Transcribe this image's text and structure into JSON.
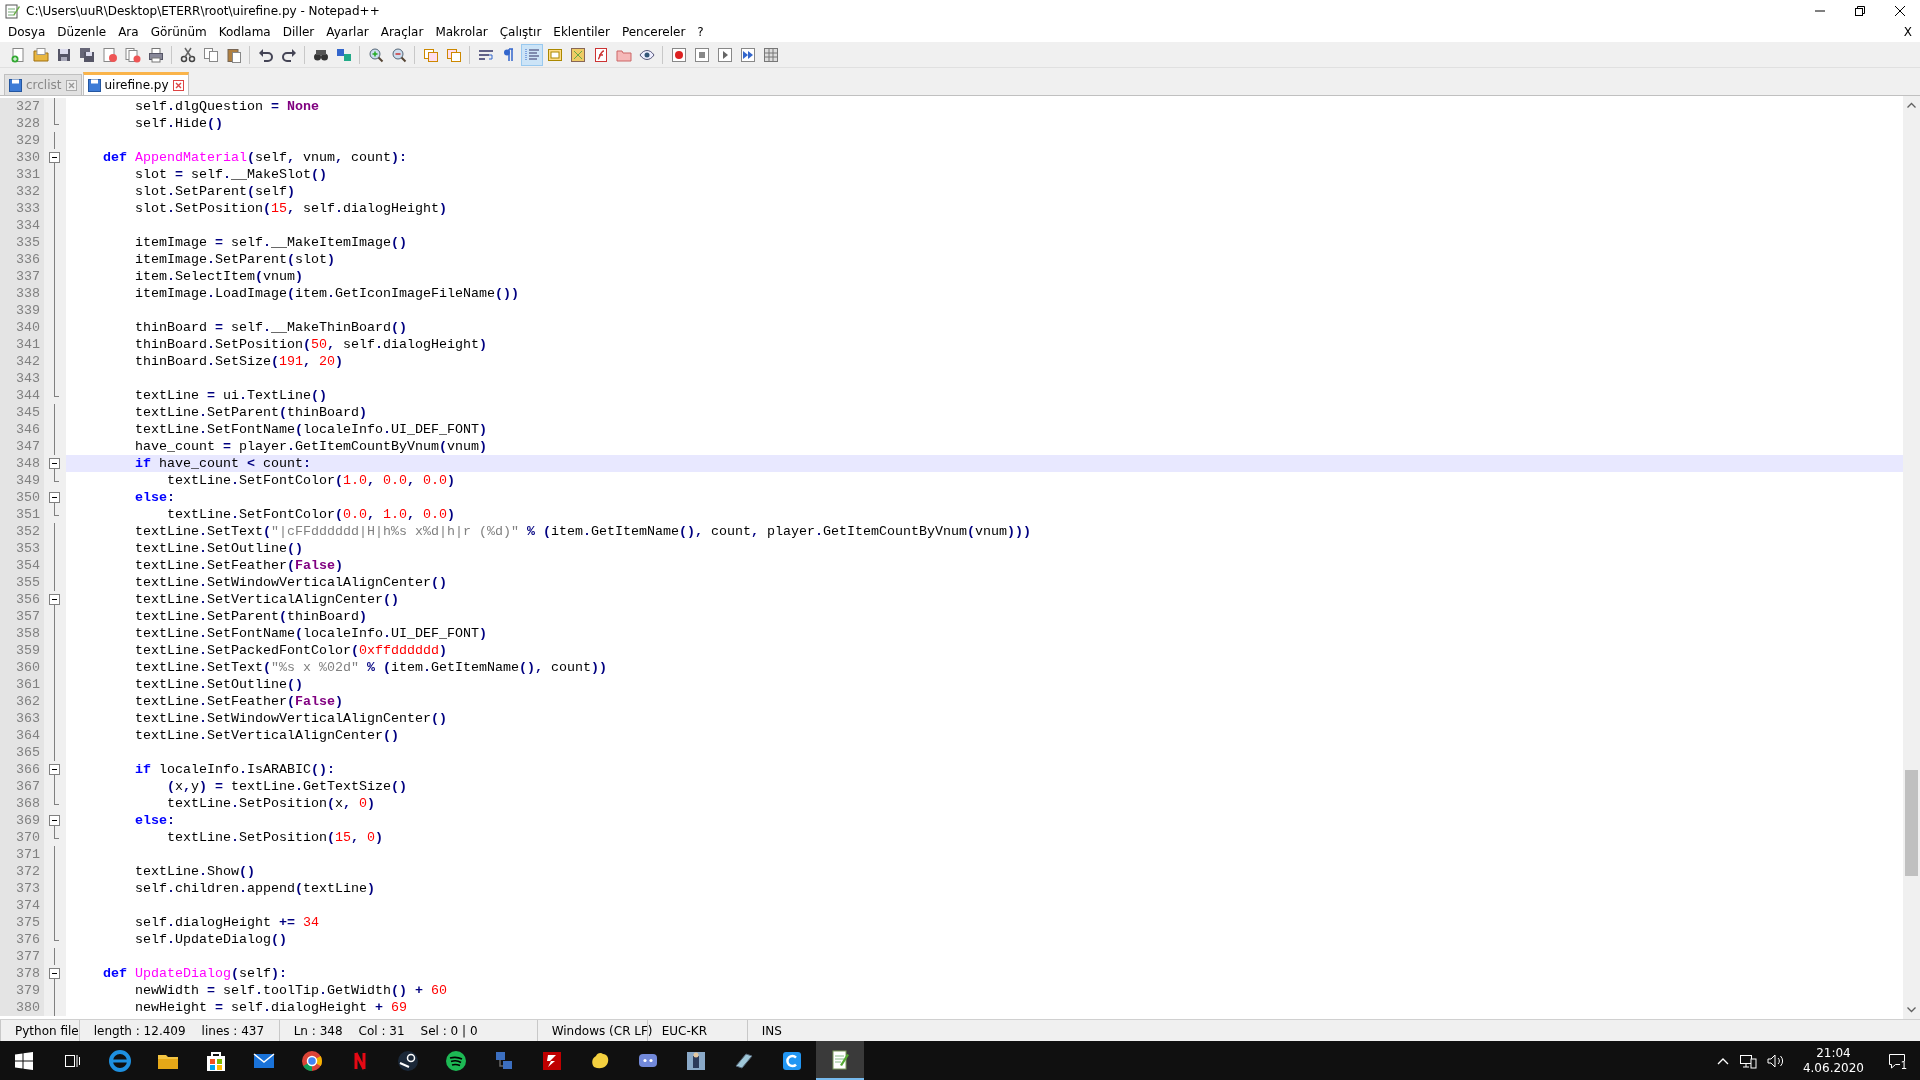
{
  "window": {
    "title": "C:\\Users\\uuR\\Desktop\\ETERR\\root\\uirefine.py - Notepad++"
  },
  "menu": {
    "items": [
      "Dosya",
      "Düzenle",
      "Ara",
      "Görünüm",
      "Kodlama",
      "Diller",
      "Ayarlar",
      "Araçlar",
      "Makrolar",
      "Çalıştır",
      "Eklentiler",
      "Pencereler",
      "?"
    ],
    "close_label": "X"
  },
  "toolbar": {
    "items": [
      {
        "kind": "button",
        "pressed": false
      },
      {
        "kind": "button",
        "pressed": false
      },
      {
        "kind": "button",
        "pressed": false
      },
      {
        "kind": "button",
        "pressed": false
      },
      {
        "kind": "button",
        "pressed": false
      },
      {
        "kind": "button",
        "pressed": false
      },
      {
        "kind": "button",
        "pressed": false
      },
      {
        "kind": "separator"
      },
      {
        "kind": "button",
        "pressed": false
      },
      {
        "kind": "button",
        "pressed": false
      },
      {
        "kind": "button",
        "pressed": false
      },
      {
        "kind": "separator"
      },
      {
        "kind": "button",
        "pressed": false
      },
      {
        "kind": "button",
        "pressed": false
      },
      {
        "kind": "separator"
      },
      {
        "kind": "button",
        "pressed": false
      },
      {
        "kind": "button",
        "pressed": false
      },
      {
        "kind": "separator"
      },
      {
        "kind": "button",
        "pressed": false
      },
      {
        "kind": "button",
        "pressed": false
      },
      {
        "kind": "separator"
      },
      {
        "kind": "button",
        "pressed": false
      },
      {
        "kind": "button",
        "pressed": false
      },
      {
        "kind": "separator"
      },
      {
        "kind": "button",
        "pressed": false
      },
      {
        "kind": "button",
        "pressed": false
      },
      {
        "kind": "button",
        "pressed": true
      },
      {
        "kind": "button",
        "pressed": false
      },
      {
        "kind": "button",
        "pressed": false
      },
      {
        "kind": "button",
        "pressed": false
      },
      {
        "kind": "button",
        "pressed": false
      },
      {
        "kind": "button",
        "pressed": false
      },
      {
        "kind": "separator"
      },
      {
        "kind": "button",
        "pressed": false
      },
      {
        "kind": "button",
        "pressed": false
      },
      {
        "kind": "button",
        "pressed": false
      },
      {
        "kind": "button",
        "pressed": false
      },
      {
        "kind": "button",
        "pressed": false
      }
    ]
  },
  "tabs": [
    {
      "label": "crclist",
      "selected": false
    },
    {
      "label": "uirefine.py",
      "selected": true
    }
  ],
  "editor": {
    "lines": [
      {
        "number": "327",
        "kind": "line",
        "selected": false,
        "tokens": [
          {
            "kind": "id",
            "text": "        self"
          },
          {
            "kind": "op",
            "text": "."
          },
          {
            "kind": "id",
            "text": "dlgQuestion "
          },
          {
            "kind": "op",
            "text": "="
          },
          {
            "kind": "constant",
            "text": " None"
          }
        ]
      },
      {
        "number": "328",
        "kind": "end",
        "selected": false,
        "tokens": [
          {
            "kind": "id",
            "text": "        self"
          },
          {
            "kind": "op",
            "text": "."
          },
          {
            "kind": "id",
            "text": "Hide"
          },
          {
            "kind": "op",
            "text": "()"
          }
        ]
      },
      {
        "number": "329",
        "kind": "line",
        "selected": false
      },
      {
        "number": "330",
        "kind": "open",
        "selected": false,
        "tokens": [
          {
            "kind": "keyword",
            "text": "    def "
          },
          {
            "kind": "defname",
            "text": "AppendMaterial"
          },
          {
            "kind": "op",
            "text": "("
          },
          {
            "kind": "id",
            "text": "self"
          },
          {
            "kind": "op",
            "text": ", "
          },
          {
            "kind": "id",
            "text": "vnum"
          },
          {
            "kind": "op",
            "text": ", "
          },
          {
            "kind": "id",
            "text": "count"
          },
          {
            "kind": "op",
            "text": "):"
          }
        ]
      },
      {
        "number": "331",
        "kind": "line",
        "selected": false,
        "tokens": [
          {
            "kind": "id",
            "text": "        slot "
          },
          {
            "kind": "op",
            "text": "="
          },
          {
            "kind": "id",
            "text": " self"
          },
          {
            "kind": "op",
            "text": "."
          },
          {
            "kind": "id",
            "text": "__MakeSlot"
          },
          {
            "kind": "op",
            "text": "()"
          }
        ]
      },
      {
        "number": "332",
        "kind": "line",
        "selected": false,
        "tokens": [
          {
            "kind": "id",
            "text": "        slot"
          },
          {
            "kind": "op",
            "text": "."
          },
          {
            "kind": "id",
            "text": "SetParent"
          },
          {
            "kind": "op",
            "text": "("
          },
          {
            "kind": "id",
            "text": "self"
          },
          {
            "kind": "op",
            "text": ")"
          }
        ]
      },
      {
        "number": "333",
        "kind": "line",
        "selected": false,
        "tokens": [
          {
            "kind": "id",
            "text": "        slot"
          },
          {
            "kind": "op",
            "text": "."
          },
          {
            "kind": "id",
            "text": "SetPosition"
          },
          {
            "kind": "op",
            "text": "("
          },
          {
            "kind": "number",
            "text": "15"
          },
          {
            "kind": "op",
            "text": ", "
          },
          {
            "kind": "id",
            "text": "self"
          },
          {
            "kind": "op",
            "text": "."
          },
          {
            "kind": "id",
            "text": "dialogHeight"
          },
          {
            "kind": "op",
            "text": ")"
          }
        ]
      },
      {
        "number": "334",
        "kind": "line",
        "selected": false
      },
      {
        "number": "335",
        "kind": "line",
        "selected": false,
        "tokens": [
          {
            "kind": "id",
            "text": "        itemImage "
          },
          {
            "kind": "op",
            "text": "="
          },
          {
            "kind": "id",
            "text": " self"
          },
          {
            "kind": "op",
            "text": "."
          },
          {
            "kind": "id",
            "text": "__MakeItemImage"
          },
          {
            "kind": "op",
            "text": "()"
          }
        ]
      },
      {
        "number": "336",
        "kind": "line",
        "selected": false,
        "tokens": [
          {
            "kind": "id",
            "text": "        itemImage"
          },
          {
            "kind": "op",
            "text": "."
          },
          {
            "kind": "id",
            "text": "SetParent"
          },
          {
            "kind": "op",
            "text": "("
          },
          {
            "kind": "id",
            "text": "slot"
          },
          {
            "kind": "op",
            "text": ")"
          }
        ]
      },
      {
        "number": "337",
        "kind": "line",
        "selected": false,
        "tokens": [
          {
            "kind": "id",
            "text": "        item"
          },
          {
            "kind": "op",
            "text": "."
          },
          {
            "kind": "id",
            "text": "SelectItem"
          },
          {
            "kind": "op",
            "text": "("
          },
          {
            "kind": "id",
            "text": "vnum"
          },
          {
            "kind": "op",
            "text": ")"
          }
        ]
      },
      {
        "number": "338",
        "kind": "line",
        "selected": false,
        "tokens": [
          {
            "kind": "id",
            "text": "        itemImage"
          },
          {
            "kind": "op",
            "text": "."
          },
          {
            "kind": "id",
            "text": "LoadImage"
          },
          {
            "kind": "op",
            "text": "("
          },
          {
            "kind": "id",
            "text": "item"
          },
          {
            "kind": "op",
            "text": "."
          },
          {
            "kind": "id",
            "text": "GetIconImageFileName"
          },
          {
            "kind": "op",
            "text": "())"
          }
        ]
      },
      {
        "number": "339",
        "kind": "line",
        "selected": false
      },
      {
        "number": "340",
        "kind": "line",
        "selected": false,
        "tokens": [
          {
            "kind": "id",
            "text": "        thinBoard "
          },
          {
            "kind": "op",
            "text": "="
          },
          {
            "kind": "id",
            "text": " self"
          },
          {
            "kind": "op",
            "text": "."
          },
          {
            "kind": "id",
            "text": "__MakeThinBoard"
          },
          {
            "kind": "op",
            "text": "()"
          }
        ]
      },
      {
        "number": "341",
        "kind": "line",
        "selected": false,
        "tokens": [
          {
            "kind": "id",
            "text": "        thinBoard"
          },
          {
            "kind": "op",
            "text": "."
          },
          {
            "kind": "id",
            "text": "SetPosition"
          },
          {
            "kind": "op",
            "text": "("
          },
          {
            "kind": "number",
            "text": "50"
          },
          {
            "kind": "op",
            "text": ", "
          },
          {
            "kind": "id",
            "text": "self"
          },
          {
            "kind": "op",
            "text": "."
          },
          {
            "kind": "id",
            "text": "dialogHeight"
          },
          {
            "kind": "op",
            "text": ")"
          }
        ]
      },
      {
        "number": "342",
        "kind": "line",
        "selected": false,
        "tokens": [
          {
            "kind": "id",
            "text": "        thinBoard"
          },
          {
            "kind": "op",
            "text": "."
          },
          {
            "kind": "id",
            "text": "SetSize"
          },
          {
            "kind": "op",
            "text": "("
          },
          {
            "kind": "number",
            "text": "191"
          },
          {
            "kind": "op",
            "text": ", "
          },
          {
            "kind": "number",
            "text": "20"
          },
          {
            "kind": "op",
            "text": ")"
          }
        ]
      },
      {
        "number": "343",
        "kind": "line",
        "selected": false
      },
      {
        "number": "344",
        "kind": "end",
        "selected": false,
        "tokens": [
          {
            "kind": "id",
            "text": "        textLine "
          },
          {
            "kind": "op",
            "text": "="
          },
          {
            "kind": "id",
            "text": " ui"
          },
          {
            "kind": "op",
            "text": "."
          },
          {
            "kind": "id",
            "text": "TextLine"
          },
          {
            "kind": "op",
            "text": "()"
          }
        ]
      },
      {
        "number": "345",
        "kind": "line",
        "selected": false,
        "tokens": [
          {
            "kind": "id",
            "text": "        textLine"
          },
          {
            "kind": "op",
            "text": "."
          },
          {
            "kind": "id",
            "text": "SetParent"
          },
          {
            "kind": "op",
            "text": "("
          },
          {
            "kind": "id",
            "text": "thinBoard"
          },
          {
            "kind": "op",
            "text": ")"
          }
        ]
      },
      {
        "number": "346",
        "kind": "line",
        "selected": false,
        "tokens": [
          {
            "kind": "id",
            "text": "        textLine"
          },
          {
            "kind": "op",
            "text": "."
          },
          {
            "kind": "id",
            "text": "SetFontName"
          },
          {
            "kind": "op",
            "text": "("
          },
          {
            "kind": "id",
            "text": "localeInfo"
          },
          {
            "kind": "op",
            "text": "."
          },
          {
            "kind": "id",
            "text": "UI_DEF_FONT"
          },
          {
            "kind": "op",
            "text": ")"
          }
        ]
      },
      {
        "number": "347",
        "kind": "line",
        "selected": false,
        "tokens": [
          {
            "kind": "id",
            "text": "        have_count "
          },
          {
            "kind": "op",
            "text": "="
          },
          {
            "kind": "id",
            "text": " player"
          },
          {
            "kind": "op",
            "text": "."
          },
          {
            "kind": "id",
            "text": "GetItemCountByVnum"
          },
          {
            "kind": "op",
            "text": "("
          },
          {
            "kind": "id",
            "text": "vnum"
          },
          {
            "kind": "op",
            "text": ")"
          }
        ]
      },
      {
        "number": "348",
        "kind": "open",
        "selected": true,
        "tokens": [
          {
            "kind": "keyword",
            "text": "        if"
          },
          {
            "kind": "id",
            "text": " have_count "
          },
          {
            "kind": "op",
            "text": "<"
          },
          {
            "kind": "id",
            "text": " count"
          },
          {
            "kind": "op",
            "text": ":"
          }
        ]
      },
      {
        "number": "349",
        "kind": "end",
        "selected": false,
        "tokens": [
          {
            "kind": "id",
            "text": "            textLine"
          },
          {
            "kind": "op",
            "text": "."
          },
          {
            "kind": "id",
            "text": "SetFontColor"
          },
          {
            "kind": "op",
            "text": "("
          },
          {
            "kind": "number",
            "text": "1.0"
          },
          {
            "kind": "op",
            "text": ", "
          },
          {
            "kind": "number",
            "text": "0.0"
          },
          {
            "kind": "op",
            "text": ", "
          },
          {
            "kind": "number",
            "text": "0.0"
          },
          {
            "kind": "op",
            "text": ")"
          }
        ]
      },
      {
        "number": "350",
        "kind": "open",
        "selected": false,
        "tokens": [
          {
            "kind": "keyword",
            "text": "        else"
          },
          {
            "kind": "op",
            "text": ":"
          }
        ]
      },
      {
        "number": "351",
        "kind": "end",
        "selected": false,
        "tokens": [
          {
            "kind": "id",
            "text": "            textLine"
          },
          {
            "kind": "op",
            "text": "."
          },
          {
            "kind": "id",
            "text": "SetFontColor"
          },
          {
            "kind": "op",
            "text": "("
          },
          {
            "kind": "number",
            "text": "0.0"
          },
          {
            "kind": "op",
            "text": ", "
          },
          {
            "kind": "number",
            "text": "1.0"
          },
          {
            "kind": "op",
            "text": ", "
          },
          {
            "kind": "number",
            "text": "0.0"
          },
          {
            "kind": "op",
            "text": ")"
          }
        ]
      },
      {
        "number": "352",
        "kind": "line",
        "selected": false,
        "tokens": [
          {
            "kind": "id",
            "text": "        textLine"
          },
          {
            "kind": "op",
            "text": "."
          },
          {
            "kind": "id",
            "text": "SetText"
          },
          {
            "kind": "op",
            "text": "("
          },
          {
            "kind": "string",
            "text": "\"|cFFdddddd|H|h%s x%d|h|r (%d)\""
          },
          {
            "kind": "op",
            "text": " % ("
          },
          {
            "kind": "id",
            "text": "item"
          },
          {
            "kind": "op",
            "text": "."
          },
          {
            "kind": "id",
            "text": "GetItemName"
          },
          {
            "kind": "op",
            "text": "(), "
          },
          {
            "kind": "id",
            "text": "count"
          },
          {
            "kind": "op",
            "text": ", "
          },
          {
            "kind": "id",
            "text": "player"
          },
          {
            "kind": "op",
            "text": "."
          },
          {
            "kind": "id",
            "text": "GetItemCountByVnum"
          },
          {
            "kind": "op",
            "text": "("
          },
          {
            "kind": "id",
            "text": "vnum"
          },
          {
            "kind": "op",
            "text": ")))"
          }
        ]
      },
      {
        "number": "353",
        "kind": "line",
        "selected": false,
        "tokens": [
          {
            "kind": "id",
            "text": "        textLine"
          },
          {
            "kind": "op",
            "text": "."
          },
          {
            "kind": "id",
            "text": "SetOutline"
          },
          {
            "kind": "op",
            "text": "()"
          }
        ]
      },
      {
        "number": "354",
        "kind": "line",
        "selected": false,
        "tokens": [
          {
            "kind": "id",
            "text": "        textLine"
          },
          {
            "kind": "op",
            "text": "."
          },
          {
            "kind": "id",
            "text": "SetFeather"
          },
          {
            "kind": "op",
            "text": "("
          },
          {
            "kind": "constant",
            "text": "False"
          },
          {
            "kind": "op",
            "text": ")"
          }
        ]
      },
      {
        "number": "355",
        "kind": "line",
        "selected": false,
        "tokens": [
          {
            "kind": "id",
            "text": "        textLine"
          },
          {
            "kind": "op",
            "text": "."
          },
          {
            "kind": "id",
            "text": "SetWindowVerticalAlignCenter"
          },
          {
            "kind": "op",
            "text": "()"
          }
        ]
      },
      {
        "number": "356",
        "kind": "open",
        "selected": false,
        "tokens": [
          {
            "kind": "id",
            "text": "        textLine"
          },
          {
            "kind": "op",
            "text": "."
          },
          {
            "kind": "id",
            "text": "SetVerticalAlignCenter"
          },
          {
            "kind": "op",
            "text": "()"
          }
        ]
      },
      {
        "number": "357",
        "kind": "line",
        "selected": false,
        "tokens": [
          {
            "kind": "id",
            "text": "        textLine"
          },
          {
            "kind": "op",
            "text": "."
          },
          {
            "kind": "id",
            "text": "SetParent"
          },
          {
            "kind": "op",
            "text": "("
          },
          {
            "kind": "id",
            "text": "thinBoard"
          },
          {
            "kind": "op",
            "text": ")"
          }
        ]
      },
      {
        "number": "358",
        "kind": "line",
        "selected": false,
        "tokens": [
          {
            "kind": "id",
            "text": "        textLine"
          },
          {
            "kind": "op",
            "text": "."
          },
          {
            "kind": "id",
            "text": "SetFontName"
          },
          {
            "kind": "op",
            "text": "("
          },
          {
            "kind": "id",
            "text": "localeInfo"
          },
          {
            "kind": "op",
            "text": "."
          },
          {
            "kind": "id",
            "text": "UI_DEF_FONT"
          },
          {
            "kind": "op",
            "text": ")"
          }
        ]
      },
      {
        "number": "359",
        "kind": "line",
        "selected": false,
        "tokens": [
          {
            "kind": "id",
            "text": "        textLine"
          },
          {
            "kind": "op",
            "text": "."
          },
          {
            "kind": "id",
            "text": "SetPackedFontColor"
          },
          {
            "kind": "op",
            "text": "("
          },
          {
            "kind": "number",
            "text": "0xffdddddd"
          },
          {
            "kind": "op",
            "text": ")"
          }
        ]
      },
      {
        "number": "360",
        "kind": "line",
        "selected": false,
        "tokens": [
          {
            "kind": "id",
            "text": "        textLine"
          },
          {
            "kind": "op",
            "text": "."
          },
          {
            "kind": "id",
            "text": "SetText"
          },
          {
            "kind": "op",
            "text": "("
          },
          {
            "kind": "string",
            "text": "\"%s x %02d\""
          },
          {
            "kind": "op",
            "text": " % ("
          },
          {
            "kind": "id",
            "text": "item"
          },
          {
            "kind": "op",
            "text": "."
          },
          {
            "kind": "id",
            "text": "GetItemName"
          },
          {
            "kind": "op",
            "text": "(), "
          },
          {
            "kind": "id",
            "text": "count"
          },
          {
            "kind": "op",
            "text": "))"
          }
        ]
      },
      {
        "number": "361",
        "kind": "line",
        "selected": false,
        "tokens": [
          {
            "kind": "id",
            "text": "        textLine"
          },
          {
            "kind": "op",
            "text": "."
          },
          {
            "kind": "id",
            "text": "SetOutline"
          },
          {
            "kind": "op",
            "text": "()"
          }
        ]
      },
      {
        "number": "362",
        "kind": "line",
        "selected": false,
        "tokens": [
          {
            "kind": "id",
            "text": "        textLine"
          },
          {
            "kind": "op",
            "text": "."
          },
          {
            "kind": "id",
            "text": "SetFeather"
          },
          {
            "kind": "op",
            "text": "("
          },
          {
            "kind": "constant",
            "text": "False"
          },
          {
            "kind": "op",
            "text": ")"
          }
        ]
      },
      {
        "number": "363",
        "kind": "line",
        "selected": false,
        "tokens": [
          {
            "kind": "id",
            "text": "        textLine"
          },
          {
            "kind": "op",
            "text": "."
          },
          {
            "kind": "id",
            "text": "SetWindowVerticalAlignCenter"
          },
          {
            "kind": "op",
            "text": "()"
          }
        ]
      },
      {
        "number": "364",
        "kind": "line",
        "selected": false,
        "tokens": [
          {
            "kind": "id",
            "text": "        textLine"
          },
          {
            "kind": "op",
            "text": "."
          },
          {
            "kind": "id",
            "text": "SetVerticalAlignCenter"
          },
          {
            "kind": "op",
            "text": "()"
          }
        ]
      },
      {
        "number": "365",
        "kind": "line",
        "selected": false
      },
      {
        "number": "366",
        "kind": "open",
        "selected": false,
        "tokens": [
          {
            "kind": "keyword",
            "text": "        if"
          },
          {
            "kind": "id",
            "text": " localeInfo"
          },
          {
            "kind": "op",
            "text": "."
          },
          {
            "kind": "id",
            "text": "IsARABIC"
          },
          {
            "kind": "op",
            "text": "():"
          }
        ]
      },
      {
        "number": "367",
        "kind": "line",
        "selected": false,
        "tokens": [
          {
            "kind": "op",
            "text": "            ("
          },
          {
            "kind": "id",
            "text": "x"
          },
          {
            "kind": "op",
            "text": ","
          },
          {
            "kind": "id",
            "text": "y"
          },
          {
            "kind": "op",
            "text": ") = "
          },
          {
            "kind": "id",
            "text": "textLine"
          },
          {
            "kind": "op",
            "text": "."
          },
          {
            "kind": "id",
            "text": "GetTextSize"
          },
          {
            "kind": "op",
            "text": "()"
          }
        ]
      },
      {
        "number": "368",
        "kind": "end",
        "selected": false,
        "tokens": [
          {
            "kind": "id",
            "text": "            textLine"
          },
          {
            "kind": "op",
            "text": "."
          },
          {
            "kind": "id",
            "text": "SetPosition"
          },
          {
            "kind": "op",
            "text": "("
          },
          {
            "kind": "id",
            "text": "x"
          },
          {
            "kind": "op",
            "text": ", "
          },
          {
            "kind": "number",
            "text": "0"
          },
          {
            "kind": "op",
            "text": ")"
          }
        ]
      },
      {
        "number": "369",
        "kind": "open",
        "selected": false,
        "tokens": [
          {
            "kind": "keyword",
            "text": "        else"
          },
          {
            "kind": "op",
            "text": ":"
          }
        ]
      },
      {
        "number": "370",
        "kind": "end",
        "selected": false,
        "tokens": [
          {
            "kind": "id",
            "text": "            textLine"
          },
          {
            "kind": "op",
            "text": "."
          },
          {
            "kind": "id",
            "text": "SetPosition"
          },
          {
            "kind": "op",
            "text": "("
          },
          {
            "kind": "number",
            "text": "15"
          },
          {
            "kind": "op",
            "text": ", "
          },
          {
            "kind": "number",
            "text": "0"
          },
          {
            "kind": "op",
            "text": ")"
          }
        ]
      },
      {
        "number": "371",
        "kind": "line",
        "selected": false
      },
      {
        "number": "372",
        "kind": "line",
        "selected": false,
        "tokens": [
          {
            "kind": "id",
            "text": "        textLine"
          },
          {
            "kind": "op",
            "text": "."
          },
          {
            "kind": "id",
            "text": "Show"
          },
          {
            "kind": "op",
            "text": "()"
          }
        ]
      },
      {
        "number": "373",
        "kind": "line",
        "selected": false,
        "tokens": [
          {
            "kind": "id",
            "text": "        self"
          },
          {
            "kind": "op",
            "text": "."
          },
          {
            "kind": "id",
            "text": "children"
          },
          {
            "kind": "op",
            "text": "."
          },
          {
            "kind": "id",
            "text": "append"
          },
          {
            "kind": "op",
            "text": "("
          },
          {
            "kind": "id",
            "text": "textLine"
          },
          {
            "kind": "op",
            "text": ")"
          }
        ]
      },
      {
        "number": "374",
        "kind": "line",
        "selected": false
      },
      {
        "number": "375",
        "kind": "line",
        "selected": false,
        "tokens": [
          {
            "kind": "id",
            "text": "        self"
          },
          {
            "kind": "op",
            "text": "."
          },
          {
            "kind": "id",
            "text": "dialogHeight "
          },
          {
            "kind": "op",
            "text": "+="
          },
          {
            "kind": "number",
            "text": " 34"
          }
        ]
      },
      {
        "number": "376",
        "kind": "end",
        "selected": false,
        "tokens": [
          {
            "kind": "id",
            "text": "        self"
          },
          {
            "kind": "op",
            "text": "."
          },
          {
            "kind": "id",
            "text": "UpdateDialog"
          },
          {
            "kind": "op",
            "text": "()"
          }
        ]
      },
      {
        "number": "377",
        "kind": "line",
        "selected": false
      },
      {
        "number": "378",
        "kind": "open",
        "selected": false,
        "tokens": [
          {
            "kind": "keyword",
            "text": "    def "
          },
          {
            "kind": "defname",
            "text": "UpdateDialog"
          },
          {
            "kind": "op",
            "text": "("
          },
          {
            "kind": "id",
            "text": "self"
          },
          {
            "kind": "op",
            "text": "):"
          }
        ]
      },
      {
        "number": "379",
        "kind": "line",
        "selected": false,
        "tokens": [
          {
            "kind": "id",
            "text": "        newWidth "
          },
          {
            "kind": "op",
            "text": "="
          },
          {
            "kind": "id",
            "text": " self"
          },
          {
            "kind": "op",
            "text": "."
          },
          {
            "kind": "id",
            "text": "toolTip"
          },
          {
            "kind": "op",
            "text": "."
          },
          {
            "kind": "id",
            "text": "GetWidth"
          },
          {
            "kind": "op",
            "text": "() + "
          },
          {
            "kind": "number",
            "text": "60"
          }
        ]
      },
      {
        "number": "380",
        "kind": "line",
        "selected": false,
        "tokens": [
          {
            "kind": "id",
            "text": "        newHeight "
          },
          {
            "kind": "op",
            "text": "="
          },
          {
            "kind": "id",
            "text": " self"
          },
          {
            "kind": "op",
            "text": "."
          },
          {
            "kind": "id",
            "text": "dialogHeight "
          },
          {
            "kind": "op",
            "text": "+"
          },
          {
            "kind": "number",
            "text": " 69"
          }
        ]
      }
    ]
  },
  "status_bar": {
    "file_type": "Python file",
    "length": "length : 12.409",
    "lines": "lines : 437",
    "ln": "Ln : 348",
    "col": "Col : 31",
    "sel": "Sel : 0 | 0",
    "eol": "Windows (CR LF)",
    "encoding": "EUC-KR",
    "mode": "INS"
  },
  "taskbar": {
    "apps": [
      {
        "selected": false
      },
      {
        "selected": false
      },
      {
        "selected": false
      },
      {
        "selected": false
      },
      {
        "selected": false
      },
      {
        "selected": false
      },
      {
        "selected": false
      },
      {
        "selected": false
      },
      {
        "selected": false
      },
      {
        "selected": false
      },
      {
        "selected": false
      },
      {
        "selected": false
      },
      {
        "selected": false
      },
      {
        "selected": false
      },
      {
        "selected": false
      },
      {
        "selected": true
      }
    ],
    "time": "21:04",
    "date": "4.06.2020",
    "notifications": "1"
  }
}
